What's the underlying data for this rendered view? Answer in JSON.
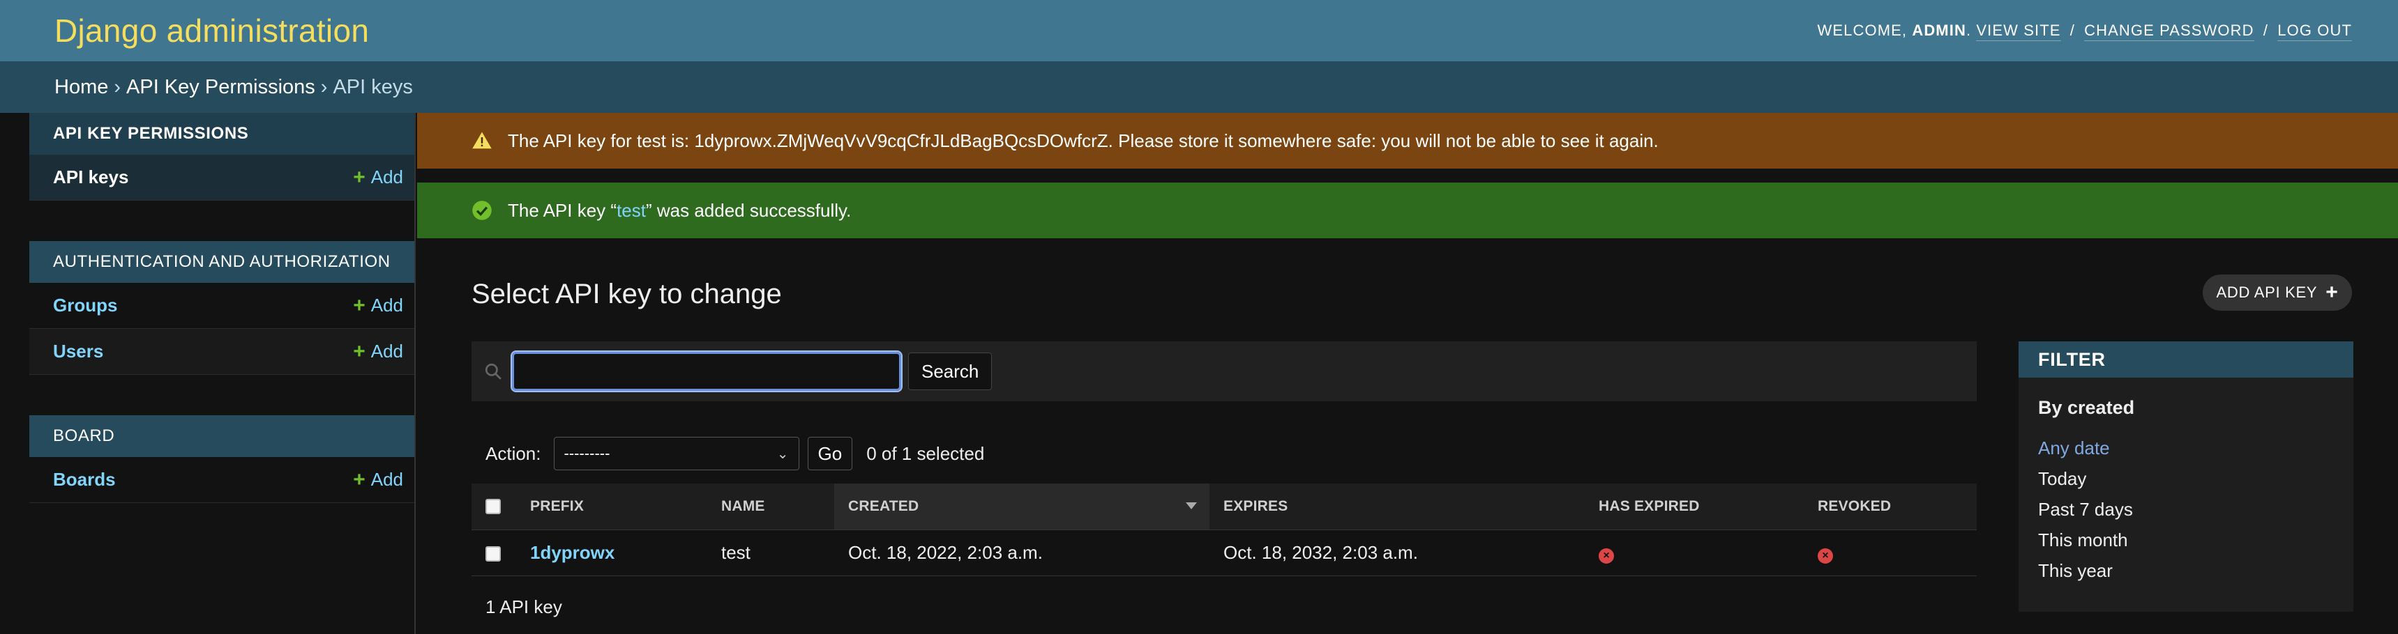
{
  "header": {
    "site_name": "Django administration",
    "welcome": "Welcome,",
    "username": "admin",
    "view_site": "View site",
    "change_password": "Change password",
    "log_out": "Log out"
  },
  "breadcrumbs": {
    "home": "Home",
    "app": "API Key Permissions",
    "current": "API keys",
    "separator": "›"
  },
  "sidebar": {
    "add_label": "Add",
    "modules": [
      {
        "caption": "API Key Permissions",
        "models": [
          {
            "name": "API keys"
          }
        ]
      },
      {
        "caption": "Authentication and Authorization",
        "models": [
          {
            "name": "Groups"
          },
          {
            "name": "Users"
          }
        ]
      },
      {
        "caption": "Board",
        "models": [
          {
            "name": "Boards"
          }
        ]
      }
    ]
  },
  "messages": {
    "warning": "The API key for test is: 1dyprowx.ZMjWeqVvV9cqCfrJLdBagBQcsDOwfcrZ. Please store it somewhere safe: you will not be able to see it again.",
    "success_prefix": "The API key “",
    "success_link": "test",
    "success_suffix": "” was added successfully."
  },
  "content": {
    "title": "Select API key to change",
    "add_button": "Add API key"
  },
  "search": {
    "value": "",
    "button": "Search"
  },
  "actions": {
    "label": "Action:",
    "selected_option": "---------",
    "go": "Go",
    "counter": "0 of 1 selected"
  },
  "table": {
    "columns": [
      "Prefix",
      "Name",
      "Created",
      "Expires",
      "Has expired",
      "Revoked"
    ],
    "rows": [
      {
        "prefix": "1dyprowx",
        "name": "test",
        "created": "Oct. 18, 2022, 2:03 a.m.",
        "expires": "Oct. 18, 2032, 2:03 a.m.",
        "has_expired": "no",
        "revoked": "no"
      }
    ],
    "paginator": "1 API key"
  },
  "filter": {
    "title": "Filter",
    "section": "By created",
    "options": [
      "Any date",
      "Today",
      "Past 7 days",
      "This month",
      "This year"
    ],
    "selected": "Any date"
  },
  "colors": {
    "header_bg": "#417690",
    "breadcrumbs_bg": "#264b5d",
    "site_name": "#f5dd5d",
    "link": "#81d4fa",
    "warning_bg": "#7a4510",
    "success_bg": "#2f6b1f",
    "add_green": "#70bf2b",
    "status_no": "#dd4646"
  }
}
